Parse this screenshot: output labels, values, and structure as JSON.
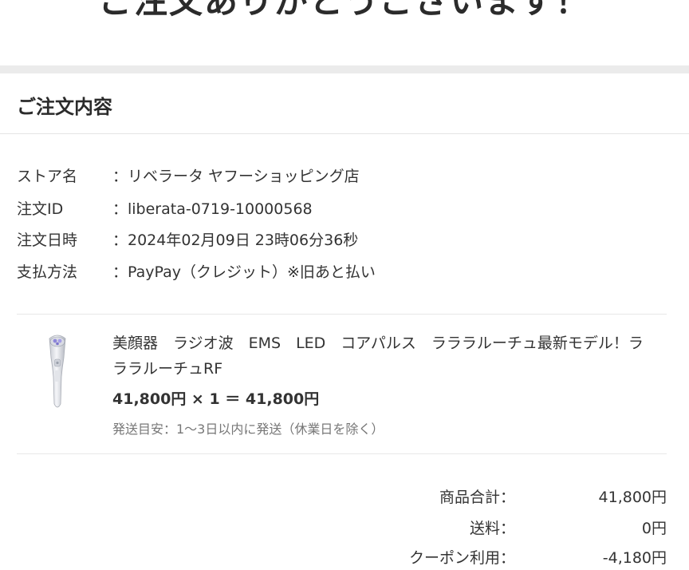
{
  "header": {
    "title": "ご注文ありがとうございます！"
  },
  "order_section": {
    "title": "ご注文内容",
    "info": [
      {
        "label": "ストア名",
        "value": "：リベラータ ヤフーショッピング店"
      },
      {
        "label": "注文ID",
        "value": "：liberata-0719-10000568"
      },
      {
        "label": "注文日時",
        "value": "：2024年02月09日 23時06分36秒"
      },
      {
        "label": "支払方法",
        "value": "：PayPay（クレジット）※旧あと払い"
      }
    ]
  },
  "product": {
    "name": "美顔器　ラジオ波　EMS　LED　コアパルス　ラララルーチュ最新モデル！ラララルーチュRF",
    "price_line": "41,800円 × 1 ＝ 41,800円",
    "shipping_note": "発送目安：1〜3日以内に発送（休業日を除く）"
  },
  "summary": [
    {
      "label": "商品合計：",
      "value": "41,800円"
    },
    {
      "label": "送料：",
      "value": "0円"
    },
    {
      "label": "クーポン利用：",
      "value": "-4,180円"
    }
  ]
}
